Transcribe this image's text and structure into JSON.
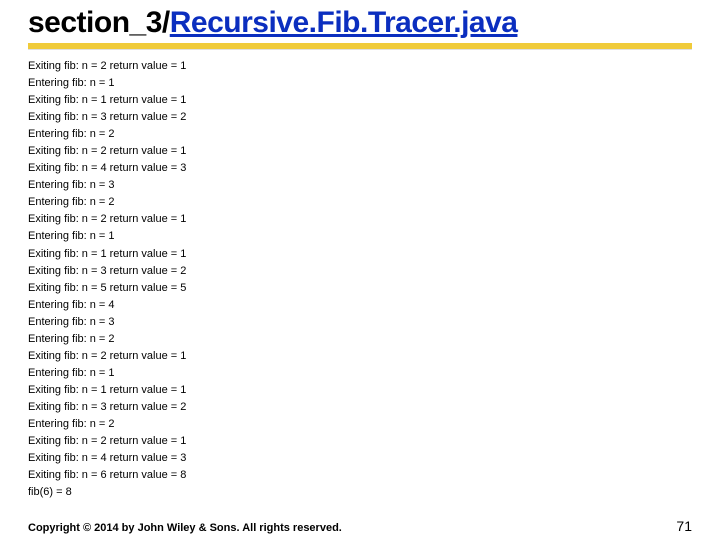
{
  "title": {
    "prefix": "section_3/",
    "linked": "Recursive.Fib.Tracer.java"
  },
  "trace_lines": [
    "Exiting fib: n = 2 return value = 1",
    "Entering fib: n = 1",
    "Exiting fib: n = 1 return value = 1",
    "Exiting fib: n = 3 return value = 2",
    "Entering fib: n = 2",
    "Exiting fib: n = 2 return value = 1",
    "Exiting fib: n = 4 return value = 3",
    "Entering fib: n = 3",
    "Entering fib: n = 2",
    "Exiting fib: n = 2 return value = 1",
    "Entering fib: n = 1",
    "Exiting fib: n = 1 return value = 1",
    "Exiting fib: n = 3 return value = 2",
    "Exiting fib: n = 5 return value = 5",
    "Entering fib: n = 4",
    "Entering fib: n = 3",
    "Entering fib: n = 2",
    "Exiting fib: n = 2 return value = 1",
    "Entering fib: n = 1",
    "Exiting fib: n = 1 return value = 1",
    "Exiting fib: n = 3 return value = 2",
    "Entering fib: n = 2",
    "Exiting fib: n = 2 return value = 1",
    "Exiting fib: n = 4 return value = 3",
    "Exiting fib: n = 6 return value = 8",
    "fib(6) = 8"
  ],
  "footer": {
    "copyright": "Copyright © 2014 by John Wiley & Sons. All rights reserved.",
    "page_number": "71"
  }
}
